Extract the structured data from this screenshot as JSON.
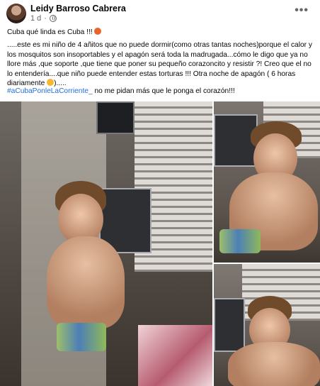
{
  "post": {
    "author": "Leidy Barroso Cabrera",
    "time": "1 d",
    "privacy_icon": "globe-icon",
    "more_icon": "more-options-icon",
    "line1": "Cuba qué linda es Cuba !!!",
    "line2": ".....este es mi niño de 4 añitos que no puede dormir(como otras tantas noches)porque el calor y los mosquitos son insoportables y el apagón será toda la madrugada...cómo le digo que ya no llore más ,que soporte ,que tiene que poner su pequeño corazoncito y resistir ?! Creo que el no lo entendería....que niño puede entender estas torturas !!! Otra noche de apagón ( 6 horas diariamente",
    "line2_end": ").....",
    "hashtag": "#aCubaPonleLaCorriente_",
    "line3": " no me pidan más que le ponga el corazón!!!"
  },
  "photos": {
    "items": [
      "main-photo",
      "photo-2",
      "photo-3"
    ]
  }
}
